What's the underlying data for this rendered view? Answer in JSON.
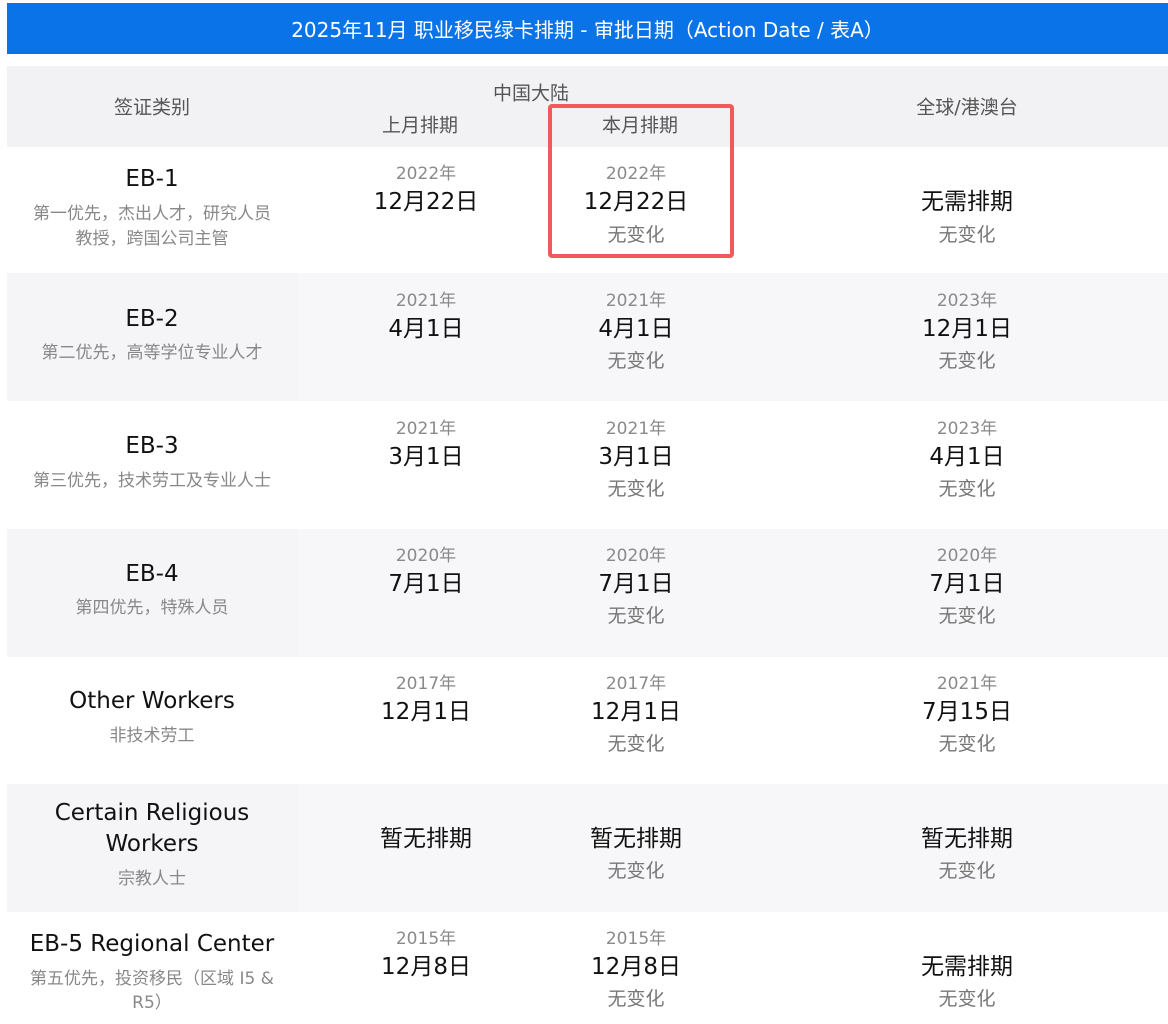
{
  "title": "2025年11月 职业移民绿卡排期 - 审批日期（Action Date / 表A）",
  "headers": {
    "category": "签证类别",
    "china": "中国大陆",
    "last_month": "上月排期",
    "this_month": "本月排期",
    "global": "全球/港澳台"
  },
  "rows": [
    {
      "name": "EB-1",
      "desc1": "第一优先，杰出人才，研究人员",
      "desc2": "教授，跨国公司主管",
      "last_year": "2022年",
      "last_date": "12月22日",
      "this_year": "2022年",
      "this_date": "12月22日",
      "this_change": "无变化",
      "global_year": "",
      "global_date": "无需排期",
      "global_change": "无变化"
    },
    {
      "name": "EB-2",
      "desc1": "第二优先，高等学位专业人才",
      "desc2": "",
      "last_year": "2021年",
      "last_date": "4月1日",
      "this_year": "2021年",
      "this_date": "4月1日",
      "this_change": "无变化",
      "global_year": "2023年",
      "global_date": "12月1日",
      "global_change": "无变化"
    },
    {
      "name": "EB-3",
      "desc1": "第三优先，技术劳工及专业人士",
      "desc2": "",
      "last_year": "2021年",
      "last_date": "3月1日",
      "this_year": "2021年",
      "this_date": "3月1日",
      "this_change": "无变化",
      "global_year": "2023年",
      "global_date": "4月1日",
      "global_change": "无变化"
    },
    {
      "name": "EB-4",
      "desc1": "第四优先，特殊人员",
      "desc2": "",
      "last_year": "2020年",
      "last_date": "7月1日",
      "this_year": "2020年",
      "this_date": "7月1日",
      "this_change": "无变化",
      "global_year": "2020年",
      "global_date": "7月1日",
      "global_change": "无变化"
    },
    {
      "name": "Other Workers",
      "desc1": "非技术劳工",
      "desc2": "",
      "last_year": "2017年",
      "last_date": "12月1日",
      "this_year": "2017年",
      "this_date": "12月1日",
      "this_change": "无变化",
      "global_year": "2021年",
      "global_date": "7月15日",
      "global_change": "无变化"
    },
    {
      "name": "Certain Religious",
      "name2": "Workers",
      "desc1": "宗教人士",
      "desc2": "",
      "last_year": "",
      "last_date": "暂无排期",
      "this_year": "",
      "this_date": "暂无排期",
      "this_change": "无变化",
      "global_year": "",
      "global_date": "暂无排期",
      "global_change": "无变化"
    },
    {
      "name": "EB-5 Regional Center",
      "desc1": "第五优先，投资移民（区域 I5 &",
      "desc2": "R5）",
      "last_year": "2015年",
      "last_date": "12月8日",
      "this_year": "2015年",
      "this_date": "12月8日",
      "this_change": "无变化",
      "global_year": "",
      "global_date": "无需排期",
      "global_change": "无变化"
    }
  ]
}
